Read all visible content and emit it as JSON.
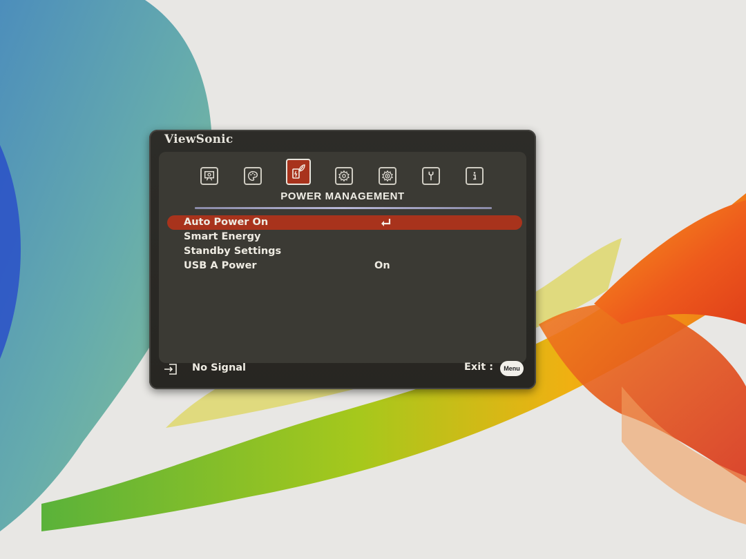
{
  "brand": "ViewSonic",
  "menu": {
    "title": "POWER MANAGEMENT",
    "tabs": [
      {
        "icon": "display-icon",
        "active": false
      },
      {
        "icon": "palette-icon",
        "active": false
      },
      {
        "icon": "power-leaf-icon",
        "active": true
      },
      {
        "icon": "gear-icon",
        "active": false
      },
      {
        "icon": "advanced-gear-icon",
        "active": false
      },
      {
        "icon": "wrench-icon",
        "active": false
      },
      {
        "icon": "info-icon",
        "active": false
      }
    ],
    "items": [
      {
        "label": "Auto Power On",
        "value": "",
        "selected": true,
        "action": "enter-icon"
      },
      {
        "label": "Smart Energy",
        "value": "",
        "selected": false
      },
      {
        "label": "Standby Settings",
        "value": "",
        "selected": false
      },
      {
        "label": "USB A Power",
        "value": "On",
        "selected": false
      }
    ]
  },
  "footer": {
    "source_icon": "input-source-icon",
    "status": "No Signal",
    "exit_label": "Exit :",
    "menu_button": "Menu"
  },
  "colors": {
    "highlight": "#a8331c",
    "panel": "#2d2c28",
    "text": "#eeebe2"
  }
}
